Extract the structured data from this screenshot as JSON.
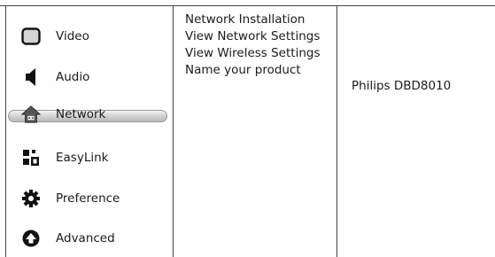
{
  "menu": {
    "items": [
      {
        "label": "Video",
        "icon": "tv-screen-icon"
      },
      {
        "label": "Audio",
        "icon": "speaker-icon"
      },
      {
        "label": "Network",
        "icon": "network-house-icon",
        "selected": true
      },
      {
        "label": "EasyLink",
        "icon": "easylink-icon"
      },
      {
        "label": "Preference",
        "icon": "gear-icon"
      },
      {
        "label": "Advanced",
        "icon": "advanced-arrow-icon"
      }
    ]
  },
  "submenu": {
    "items": [
      "Network Installation",
      "View Network Settings",
      "View Wireless Settings",
      "Name your product"
    ]
  },
  "value_column": {
    "product_name": "Philips DBD8010"
  }
}
